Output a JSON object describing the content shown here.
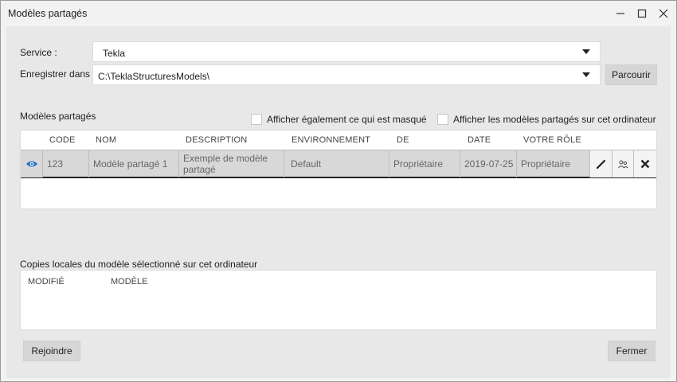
{
  "window": {
    "title": "Modèles partagés"
  },
  "service": {
    "label": "Service :",
    "value": "Tekla"
  },
  "save_in": {
    "label": "Enregistrer dans :",
    "value": "C:\\TeklaStructuresModels\\",
    "browse_label": "Parcourir"
  },
  "shared_models": {
    "title": "Modèles partagés",
    "show_hidden_label": "Afficher également ce qui est masqué",
    "show_on_computer_label": "Afficher les modèles partagés sur cet ordinateur",
    "columns": [
      "CODE",
      "NOM",
      "DESCRIPTION",
      "ENVIRONNEMENT",
      "DE",
      "DATE",
      "VOTRE RÔLE"
    ],
    "rows": [
      {
        "code": "123",
        "name": "Modèle partagé 1",
        "description": "Exemple de modèle partagé",
        "environment": "Default",
        "from": "Propriétaire",
        "date": "2019-07-25",
        "role": "Propriétaire"
      }
    ]
  },
  "local_copies": {
    "title": "Copies locales du modèle sélectionné sur cet ordinateur",
    "columns": [
      "MODIFIÉ",
      "MODÈLE"
    ]
  },
  "footer": {
    "join_label": "Rejoindre",
    "close_label": "Fermer"
  },
  "icons": {
    "visibility": "eye-icon",
    "edit": "pencil-icon",
    "users": "users-icon",
    "delete": "close-icon"
  },
  "colors": {
    "accent": "#1e6fbf",
    "selected_row": "#d8d8d8"
  }
}
